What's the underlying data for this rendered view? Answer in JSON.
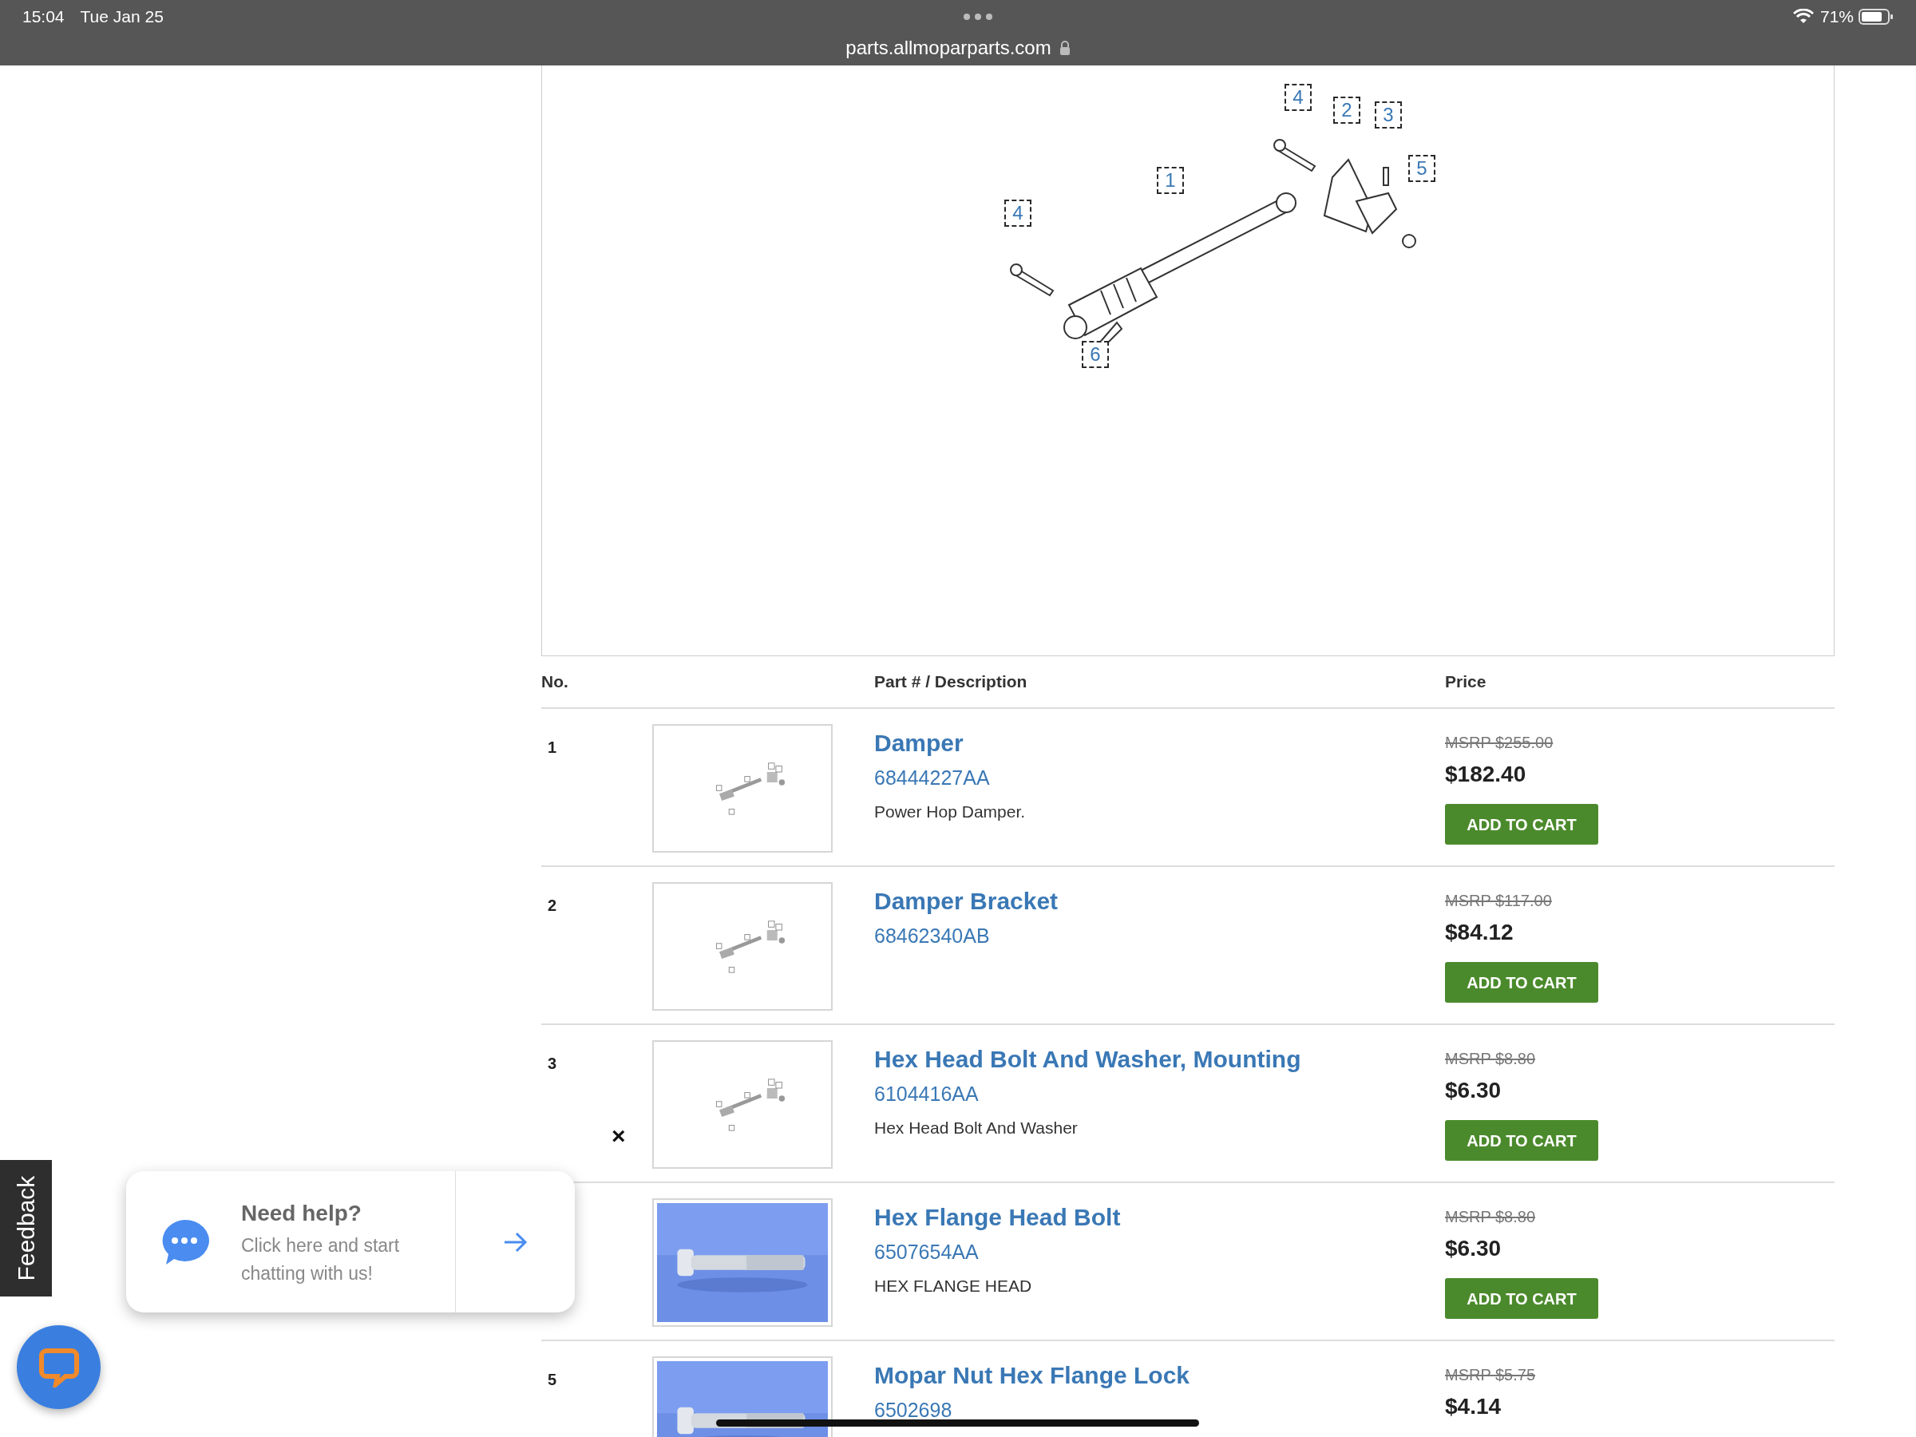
{
  "status_bar": {
    "time": "15:04",
    "date": "Tue Jan 25",
    "url": "parts.allmoparparts.com",
    "battery": "71%"
  },
  "diagram": {
    "callouts": [
      {
        "label": "4"
      },
      {
        "label": "2"
      },
      {
        "label": "3"
      },
      {
        "label": "5"
      },
      {
        "label": "1"
      },
      {
        "label": "4"
      },
      {
        "label": "6"
      }
    ]
  },
  "table": {
    "columns": [
      "No.",
      "Part # / Description",
      "Price"
    ],
    "rows": [
      {
        "number": "1",
        "photo": false,
        "title": "Damper",
        "part_number": "68444227AA",
        "description": "Power Hop Damper.",
        "msrp": "MSRP $255.00",
        "price": "$182.40",
        "button": "ADD TO CART"
      },
      {
        "number": "2",
        "photo": false,
        "title": "Damper Bracket",
        "part_number": "68462340AB",
        "msrp": "MSRP $117.00",
        "price": "$84.12",
        "button": "ADD TO CART"
      },
      {
        "number": "3",
        "photo": false,
        "title": "Hex Head Bolt And Washer, Mounting",
        "part_number": "6104416AA",
        "description": "Hex Head Bolt And Washer",
        "msrp": "MSRP $8.80",
        "price": "$6.30",
        "button": "ADD TO CART"
      },
      {
        "photo": true,
        "title": "Hex Flange Head Bolt",
        "part_number": "6507654AA",
        "description": "HEX FLANGE HEAD",
        "msrp": "MSRP $8.80",
        "price": "$6.30",
        "button": "ADD TO CART"
      },
      {
        "number": "5",
        "photo": true,
        "title": "Mopar Nut Hex Flange Lock",
        "part_number": "6502698",
        "msrp": "MSRP $5.75",
        "price": "$4.14"
      }
    ]
  },
  "chat": {
    "close": "×",
    "title": "Need help?",
    "message": "Click here and start chatting with us!"
  },
  "feedback": {
    "label": "Feedback"
  }
}
